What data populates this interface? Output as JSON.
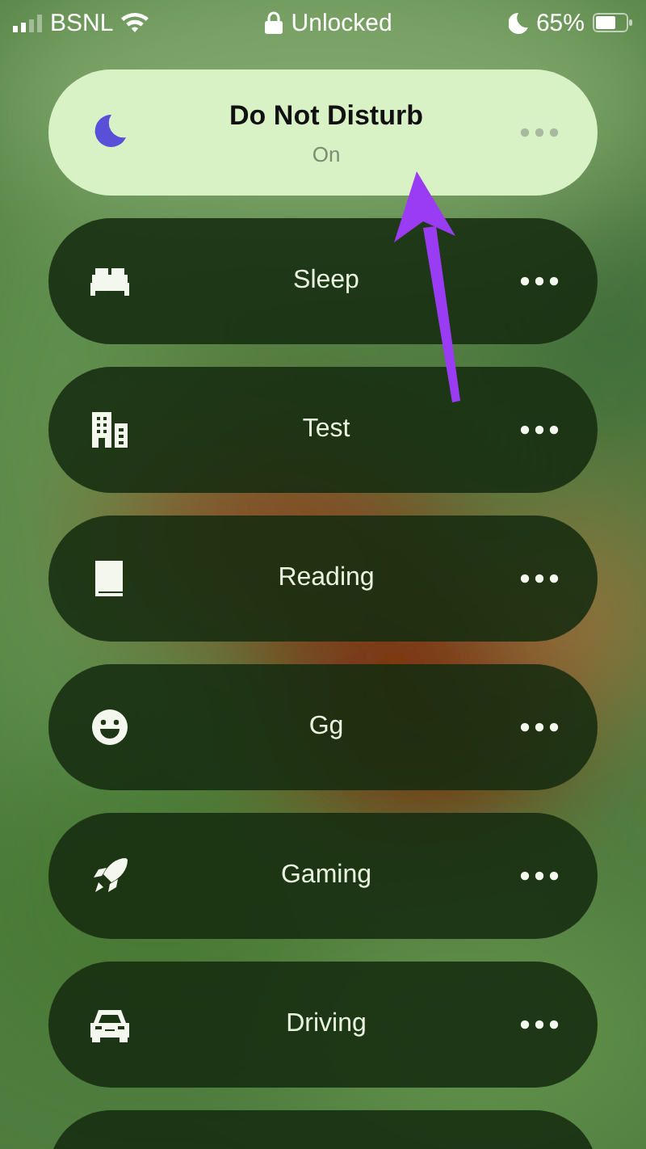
{
  "status_bar": {
    "carrier": "BSNL",
    "lock_text": "Unlocked",
    "battery": "65%"
  },
  "focus_modes": [
    {
      "label": "Do Not Disturb",
      "status": "On",
      "selected": true
    },
    {
      "label": "Sleep",
      "selected": false
    },
    {
      "label": "Test",
      "selected": false
    },
    {
      "label": "Reading",
      "selected": false
    },
    {
      "label": "Gg",
      "selected": false
    },
    {
      "label": "Gaming",
      "selected": false
    },
    {
      "label": "Driving",
      "selected": false
    }
  ]
}
